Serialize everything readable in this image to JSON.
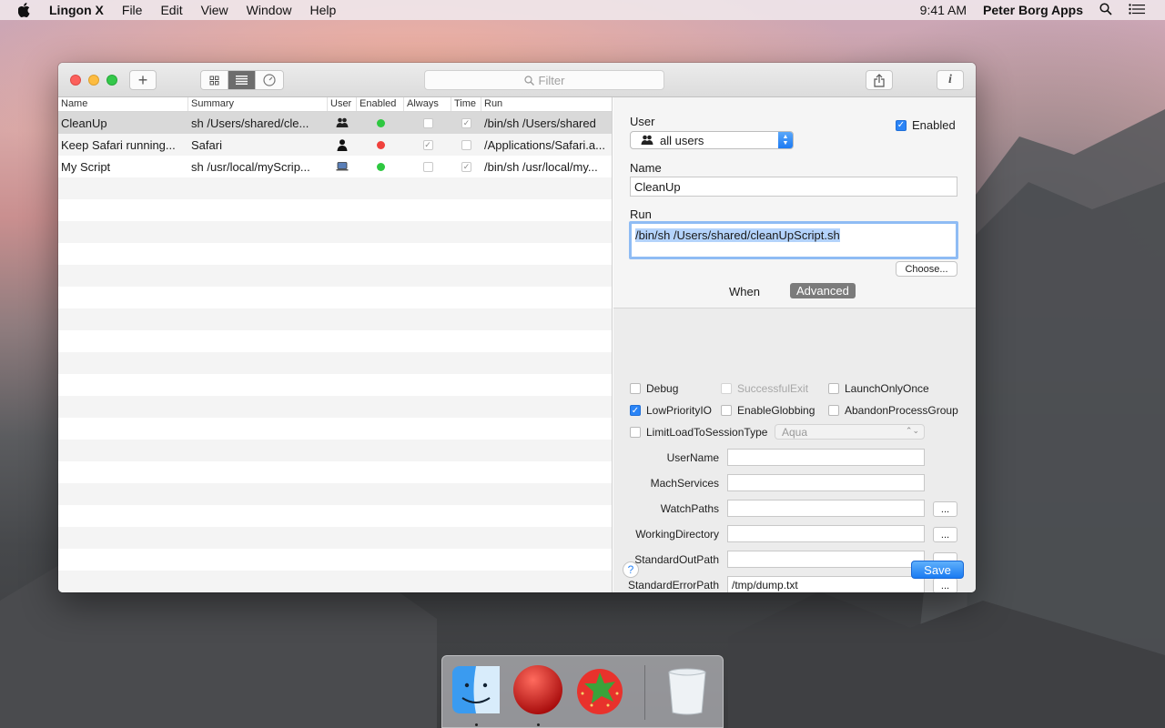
{
  "menubar": {
    "app_name": "Lingon X",
    "menus": [
      "File",
      "Edit",
      "View",
      "Window",
      "Help"
    ],
    "time": "9:41 AM",
    "owner": "Peter Borg Apps"
  },
  "toolbar": {
    "add_label": "+",
    "filter_placeholder": "Filter",
    "info_label": "i"
  },
  "list": {
    "columns": [
      "Name",
      "Summary",
      "User",
      "Enabled",
      "Always",
      "Time",
      "Run"
    ],
    "rows": [
      {
        "name": "CleanUp",
        "summary": "sh /Users/shared/cle...",
        "user_icon": "users-group-icon",
        "enabled_color": "#2ec840",
        "always": false,
        "time": true,
        "run": "/bin/sh /Users/shared"
      },
      {
        "name": "Keep Safari running...",
        "summary": "Safari",
        "user_icon": "user-single-icon",
        "enabled_color": "#f0413c",
        "always": true,
        "time": false,
        "run": "/Applications/Safari.a..."
      },
      {
        "name": "My Script",
        "summary": "sh /usr/local/myScrip...",
        "user_icon": "computer-icon",
        "enabled_color": "#2ec840",
        "always": false,
        "time": true,
        "run": "/bin/sh /usr/local/my..."
      }
    ]
  },
  "detail": {
    "user_label": "User",
    "user_value": "all users",
    "enabled_label": "Enabled",
    "name_label": "Name",
    "name_value": "CleanUp",
    "run_label": "Run",
    "run_value": "/bin/sh /Users/shared/cleanUpScript.sh",
    "choose_label": "Choose...",
    "tab_when": "When",
    "tab_advanced": "Advanced",
    "options": {
      "debug": "Debug",
      "successful_exit": "SuccessfulExit",
      "launch_only_once": "LaunchOnlyOnce",
      "low_priority_io": "LowPriorityIO",
      "enable_globbing": "EnableGlobbing",
      "abandon_process_group": "AbandonProcessGroup",
      "limit_load": "LimitLoadToSessionType",
      "session_type": "Aqua"
    },
    "fields": {
      "user_name": "UserName",
      "mach_services": "MachServices",
      "watch_paths": "WatchPaths",
      "working_directory": "WorkingDirectory",
      "standard_out_path": "StandardOutPath",
      "standard_error_path": "StandardErrorPath",
      "standard_error_value": "/tmp/dump.txt"
    },
    "dots_label": "...",
    "help_label": "?",
    "save_label": "Save"
  }
}
